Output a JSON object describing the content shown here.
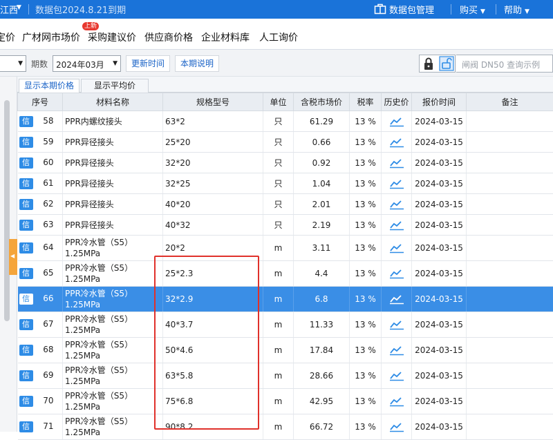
{
  "topbar": {
    "region": "江西",
    "package_status": "数据包2024.8.21到期",
    "manage_label": "数据包管理",
    "buy_label": "购买",
    "help_label": "帮助"
  },
  "nav": {
    "items": [
      "定价",
      "广材网市场价",
      "采购建议价",
      "供应商价格",
      "企业材料库",
      "人工询价"
    ],
    "badge": "上新"
  },
  "toolbar": {
    "period_label": "期数",
    "period_value": "2024年03月",
    "update_time_label": "更新时间",
    "notes_label": "本期说明",
    "search_placeholder": "闸阀 DN50 查询示例"
  },
  "subtabs": [
    "显示本期价格",
    "显示平均价"
  ],
  "table": {
    "headers": [
      "序号",
      "材料名称",
      "规格型号",
      "单位",
      "含税市场价",
      "税率",
      "历史价",
      "报价时间",
      "备注"
    ],
    "badge": "信",
    "rows": [
      {
        "seq": "58",
        "name": "PPR内螺纹接头",
        "spec": "63*2",
        "unit": "只",
        "price": "61.29",
        "tax": "13 %",
        "date": "2024-03-15"
      },
      {
        "seq": "59",
        "name": "PPR异径接头",
        "spec": "25*20",
        "unit": "只",
        "price": "0.66",
        "tax": "13 %",
        "date": "2024-03-15"
      },
      {
        "seq": "60",
        "name": "PPR异径接头",
        "spec": "32*20",
        "unit": "只",
        "price": "0.92",
        "tax": "13 %",
        "date": "2024-03-15"
      },
      {
        "seq": "61",
        "name": "PPR异径接头",
        "spec": "32*25",
        "unit": "只",
        "price": "1.04",
        "tax": "13 %",
        "date": "2024-03-15"
      },
      {
        "seq": "62",
        "name": "PPR异径接头",
        "spec": "40*20",
        "unit": "只",
        "price": "2.01",
        "tax": "13 %",
        "date": "2024-03-15"
      },
      {
        "seq": "63",
        "name": "PPR异径接头",
        "spec": "40*32",
        "unit": "只",
        "price": "2.19",
        "tax": "13 %",
        "date": "2024-03-15"
      },
      {
        "seq": "64",
        "name": "PPR冷水管（S5）1.25MPa",
        "spec": "20*2",
        "unit": "m",
        "price": "3.11",
        "tax": "13 %",
        "date": "2024-03-15"
      },
      {
        "seq": "65",
        "name": "PPR冷水管（S5）1.25MPa",
        "spec": "25*2.3",
        "unit": "m",
        "price": "4.4",
        "tax": "13 %",
        "date": "2024-03-15"
      },
      {
        "seq": "66",
        "name": "PPR冷水管（S5）1.25MPa",
        "spec": "32*2.9",
        "unit": "m",
        "price": "6.8",
        "tax": "13 %",
        "date": "2024-03-15"
      },
      {
        "seq": "67",
        "name": "PPR冷水管（S5）1.25MPa",
        "spec": "40*3.7",
        "unit": "m",
        "price": "11.33",
        "tax": "13 %",
        "date": "2024-03-15"
      },
      {
        "seq": "68",
        "name": "PPR冷水管（S5）1.25MPa",
        "spec": "50*4.6",
        "unit": "m",
        "price": "17.84",
        "tax": "13 %",
        "date": "2024-03-15"
      },
      {
        "seq": "69",
        "name": "PPR冷水管（S5）1.25MPa",
        "spec": "63*5.8",
        "unit": "m",
        "price": "28.66",
        "tax": "13 %",
        "date": "2024-03-15"
      },
      {
        "seq": "70",
        "name": "PPR冷水管（S5）1.25MPa",
        "spec": "75*6.8",
        "unit": "m",
        "price": "42.95",
        "tax": "13 %",
        "date": "2024-03-15"
      },
      {
        "seq": "71",
        "name": "PPR冷水管（S5）1.25MPa",
        "spec": "90*8.2",
        "unit": "m",
        "price": "66.72",
        "tax": "13 %",
        "date": "2024-03-15"
      }
    ]
  },
  "colors": {
    "brand": "#1a73d9",
    "selected_row": "#3a8ee6",
    "highlight_box": "#e0302a",
    "badge_red": "#e8382f"
  },
  "icons": [
    "gift-icon",
    "lock-icon",
    "unlock-icon",
    "trend-chart-icon"
  ]
}
